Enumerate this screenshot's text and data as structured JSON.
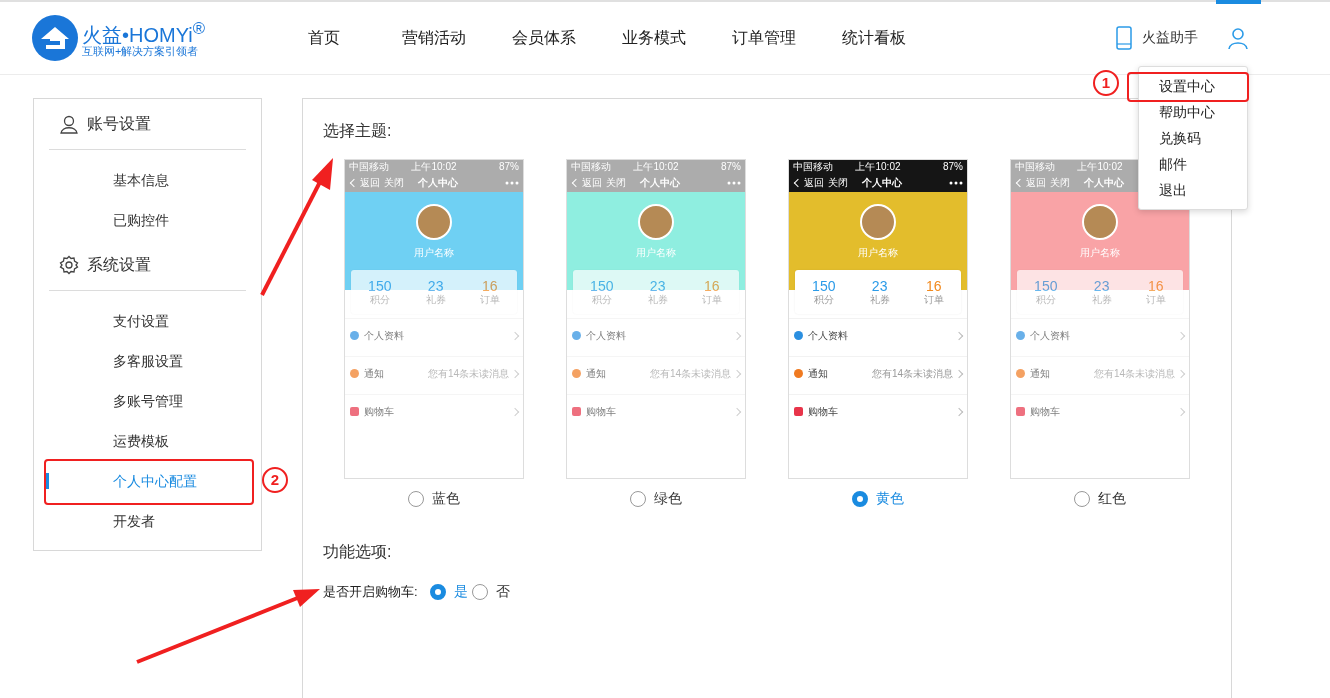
{
  "brand": {
    "title": "火益•HOMYi$^{®}$",
    "tagline": "互联网+解决方案引领者"
  },
  "nav": [
    "首页",
    "营销活动",
    "会员体系",
    "业务模式",
    "订单管理",
    "统计看板"
  ],
  "assistant": "火益助手",
  "user_menu": {
    "open": true,
    "items": [
      {
        "label": "设置中心",
        "callout": "1"
      },
      {
        "label": "帮助中心"
      },
      {
        "label": "兑换码"
      },
      {
        "label": "邮件"
      },
      {
        "label": "退出"
      }
    ]
  },
  "sidebar": [
    {
      "kind": "account",
      "title": "账号设置",
      "items": [
        {
          "label": "基本信息",
          "selected": false
        },
        {
          "label": "已购控件",
          "selected": false
        }
      ]
    },
    {
      "kind": "system",
      "title": "系统设置",
      "items": [
        {
          "label": "支付设置",
          "selected": false
        },
        {
          "label": "多客服设置",
          "selected": false
        },
        {
          "label": "多账号管理",
          "selected": false
        },
        {
          "label": "运费模板",
          "selected": false
        },
        {
          "label": "个人中心配置",
          "selected": true,
          "callout": "2"
        },
        {
          "label": "开发者",
          "selected": false
        }
      ]
    }
  ],
  "theme_section": {
    "title": "选择主题:",
    "themes": [
      {
        "label": "蓝色",
        "selected": false,
        "color": "#6fd0f3",
        "preview": {
          "carrier": "中国移动",
          "time": "上午10:02",
          "battery": "87%",
          "back": "返回",
          "close": "关闭",
          "title": "个人中心",
          "username": "用户名称",
          "stats": [
            {
              "value": "150",
              "label": "积分"
            },
            {
              "value": "23",
              "label": "礼券"
            },
            {
              "value": "16",
              "label": "订单"
            }
          ],
          "rows": [
            {
              "label": "个人资料"
            },
            {
              "label": "通知",
              "note": "您有14条未读消息"
            },
            {
              "label": "购物车"
            }
          ]
        }
      },
      {
        "label": "绿色",
        "selected": false,
        "color": "#8feee0",
        "preview": {
          "carrier": "中国移动",
          "time": "上午10:02",
          "battery": "87%",
          "back": "返回",
          "close": "关闭",
          "title": "个人中心",
          "username": "用户名称",
          "stats": [
            {
              "value": "150",
              "label": "积分"
            },
            {
              "value": "23",
              "label": "礼券"
            },
            {
              "value": "16",
              "label": "订单"
            }
          ],
          "rows": [
            {
              "label": "个人资料"
            },
            {
              "label": "通知",
              "note": "您有14条未读消息"
            },
            {
              "label": "购物车"
            }
          ]
        }
      },
      {
        "label": "黄色",
        "selected": true,
        "color": "#e3bd2c",
        "preview": {
          "carrier": "中国移动",
          "time": "上午10:02",
          "battery": "87%",
          "back": "返回",
          "close": "关闭",
          "title": "个人中心",
          "username": "用户名称",
          "stats": [
            {
              "value": "150",
              "label": "积分"
            },
            {
              "value": "23",
              "label": "礼券"
            },
            {
              "value": "16",
              "label": "订单"
            }
          ],
          "rows": [
            {
              "label": "个人资料"
            },
            {
              "label": "通知",
              "note": "您有14条未读消息"
            },
            {
              "label": "购物车"
            }
          ]
        }
      },
      {
        "label": "红色",
        "selected": false,
        "color": "#f9a3a6",
        "preview": {
          "carrier": "中国移动",
          "time": "上午10:02",
          "back": "返回",
          "close": "关闭",
          "title": "个人中心",
          "username": "用户名称",
          "stats": [
            {
              "value": "150",
              "label": "积分"
            },
            {
              "value": "23",
              "label": "礼券"
            },
            {
              "value": "16",
              "label": "订单"
            }
          ],
          "rows": [
            {
              "label": "个人资料"
            },
            {
              "label": "通知",
              "note": "您有14条未读消息"
            },
            {
              "label": "购物车"
            }
          ]
        }
      }
    ]
  },
  "options_section": {
    "title": "功能选项:",
    "cart": {
      "label": "是否开启购物车:",
      "choices": [
        {
          "label": "是",
          "selected": true
        },
        {
          "label": "否",
          "selected": false
        }
      ]
    }
  }
}
